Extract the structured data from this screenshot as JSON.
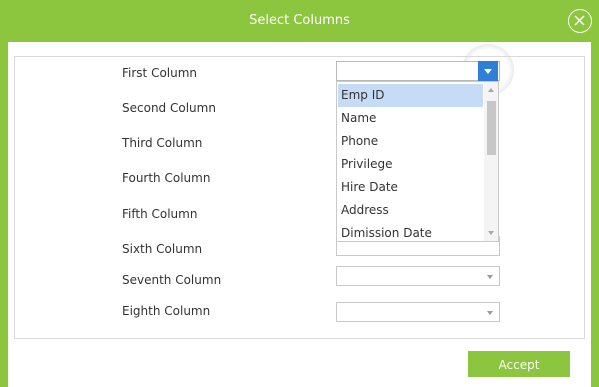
{
  "dialog": {
    "title": "Select Columns",
    "close_icon": "close-circle-icon",
    "accept_label": "Accept",
    "accent_color": "#8cc63f"
  },
  "columns": [
    {
      "label": "First Column",
      "value": ""
    },
    {
      "label": "Second Column",
      "value": ""
    },
    {
      "label": "Third Column",
      "value": ""
    },
    {
      "label": "Fourth Column",
      "value": ""
    },
    {
      "label": "Fifth Column",
      "value": ""
    },
    {
      "label": "Sixth Column",
      "value": ""
    },
    {
      "label": "Seventh Column",
      "value": ""
    },
    {
      "label": "Eighth Column",
      "value": ""
    }
  ],
  "dropdown": {
    "open_for": "First Column",
    "selected": "Emp ID",
    "options": [
      "Emp ID",
      "Name",
      "Phone",
      "Privilege",
      "Hire Date",
      "Address",
      "Dimission Date"
    ]
  }
}
